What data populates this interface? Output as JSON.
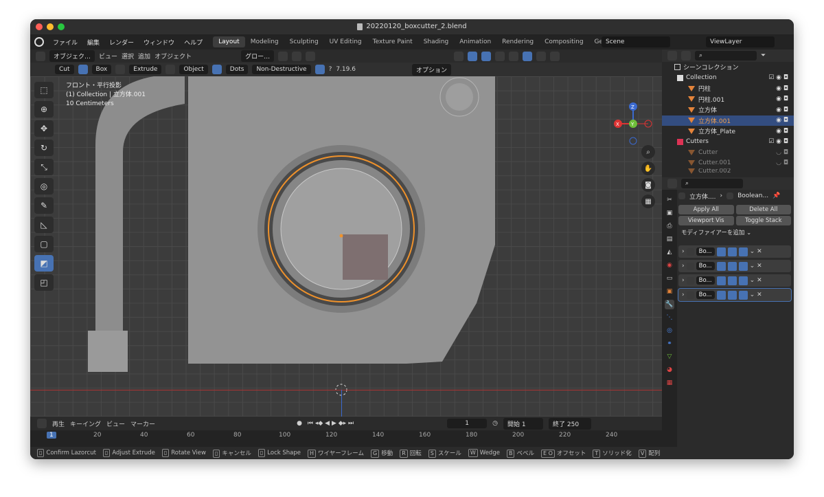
{
  "window": {
    "title": "20220120_boxcutter_2.blend"
  },
  "menubar": {
    "items": [
      "ファイル",
      "編集",
      "レンダー",
      "ウィンドウ",
      "ヘルプ"
    ],
    "workspaces": [
      "Layout",
      "Modeling",
      "Sculpting",
      "UV Editing",
      "Texture Paint",
      "Shading",
      "Animation",
      "Rendering",
      "Compositing",
      "Geometry"
    ],
    "active_workspace": "Layout",
    "scene": "Scene",
    "view_layer": "ViewLayer"
  },
  "viewport_header": {
    "mode": "オブジェク…",
    "menus": [
      "ビュー",
      "選択",
      "追加",
      "オブジェクト"
    ],
    "transform_orientation": "グロー…"
  },
  "tool_header": {
    "cut": "Cut",
    "box": "Box",
    "extrude": "Extrude",
    "object": "Object",
    "dots": "Dots",
    "mode": "Non-Destructive",
    "version": "7.19.6",
    "options": "オプション"
  },
  "viewport": {
    "info_line1": "フロント・平行投影",
    "info_line2": "(1) Collection | 立方体.001",
    "info_line3": "10 Centimeters",
    "gizmo_labels": {
      "x": "X",
      "y": "Y",
      "z": "Z"
    },
    "colors": {
      "selected_outline": "#f0922b",
      "box_preview": "#7e6f70"
    }
  },
  "toolbar": {
    "tools": [
      "select-box",
      "cursor",
      "move",
      "rotate",
      "scale",
      "transform",
      "annotate",
      "measure",
      "add-cube",
      "boxcutter",
      "hops"
    ]
  },
  "timeline": {
    "menus": [
      "再生",
      "キーイング",
      "ビュー",
      "マーカー"
    ],
    "current_frame": "1",
    "start_label": "開始",
    "start_value": "1",
    "end_label": "終了",
    "end_value": "250",
    "ruler": [
      "1",
      "20",
      "40",
      "60",
      "80",
      "100",
      "120",
      "140",
      "160",
      "180",
      "200",
      "220",
      "240"
    ]
  },
  "statusbar": [
    {
      "key": "",
      "label": "Confirm Lazorcut"
    },
    {
      "key": "",
      "label": "Adjust Extrude"
    },
    {
      "key": "",
      "label": "Rotate View"
    },
    {
      "key": "",
      "label": "キャンセル"
    },
    {
      "key": "",
      "label": "Lock Shape"
    },
    {
      "key": "H",
      "label": "ワイヤーフレーム"
    },
    {
      "key": "G",
      "label": "移動"
    },
    {
      "key": "R",
      "label": "回転"
    },
    {
      "key": "S",
      "label": "スケール"
    },
    {
      "key": "W",
      "label": "Wedge"
    },
    {
      "key": "B",
      "label": "ベベル"
    },
    {
      "key": "E O",
      "label": "オフセット"
    },
    {
      "key": "T",
      "label": "ソリッド化"
    },
    {
      "key": "V",
      "label": "配列"
    }
  ],
  "outliner": {
    "root": "シーンコレクション",
    "rows": [
      {
        "name": "Collection",
        "type": "collection",
        "selected": false
      },
      {
        "name": "円柱",
        "type": "mesh",
        "selected": false
      },
      {
        "name": "円柱.001",
        "type": "mesh",
        "selected": false
      },
      {
        "name": "立方体",
        "type": "mesh",
        "selected": false
      },
      {
        "name": "立方体.001",
        "type": "mesh",
        "selected": true
      },
      {
        "name": "立方体_Plate",
        "type": "mesh",
        "selected": false
      },
      {
        "name": "Cutters",
        "type": "collection",
        "selected": false
      },
      {
        "name": "Cutter",
        "type": "mesh",
        "selected": false
      },
      {
        "name": "Cutter.001",
        "type": "mesh",
        "selected": false
      },
      {
        "name": "Cutter.002",
        "type": "mesh",
        "selected": false
      }
    ]
  },
  "properties": {
    "breadcrumb_object": "立方体....",
    "breadcrumb_modifier": "Boolean...",
    "apply_all": "Apply All",
    "delete_all": "Delete All",
    "viewport_vis": "Viewport Vis",
    "toggle_stack": "Toggle Stack",
    "add_modifier": "モディファイアーを追加",
    "modifiers": [
      "Bo...",
      "Bo...",
      "Bo...",
      "Bo..."
    ]
  }
}
